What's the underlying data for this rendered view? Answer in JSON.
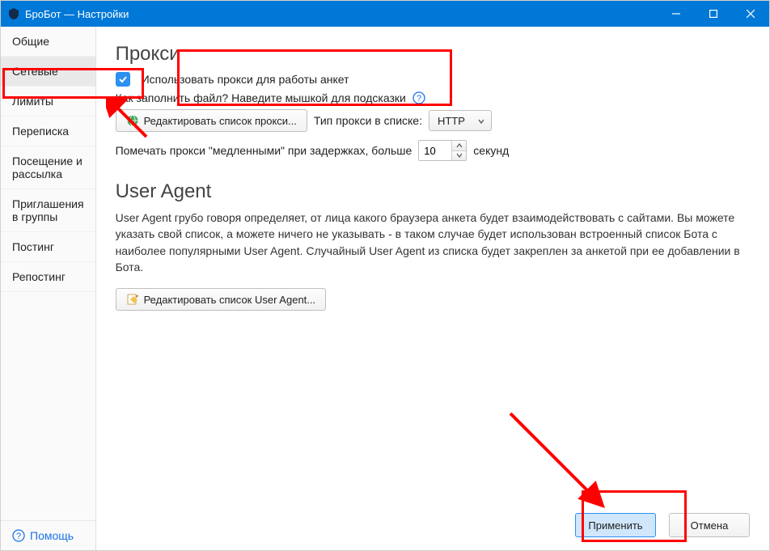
{
  "window": {
    "title": "БроБот — Настройки"
  },
  "sidebar": {
    "items": [
      {
        "label": "Общие"
      },
      {
        "label": "Сетевые",
        "selected": true
      },
      {
        "label": "Лимиты"
      },
      {
        "label": "Переписка"
      },
      {
        "label": "Посещение и рассылка"
      },
      {
        "label": "Приглашения в группы"
      },
      {
        "label": "Постинг"
      },
      {
        "label": "Репостинг"
      }
    ],
    "help": "Помощь"
  },
  "proxy": {
    "heading": "Прокси",
    "use_proxy_label": "Использовать прокси для работы анкет",
    "use_proxy_checked": true,
    "howto_text": "Как заполнить файл? Наведите мышкой для подсказки",
    "edit_list_label": "Редактировать список прокси...",
    "type_label": "Тип прокси в списке:",
    "type_value": "HTTP",
    "slow_label_pre": "Помечать прокси \"медленными\" при задержках, больше",
    "slow_value": "10",
    "slow_label_post": "секунд"
  },
  "useragent": {
    "heading": "User Agent",
    "desc": "User Agent грубо говоря определяет, от лица какого браузера анкета будет взаимодействовать с сайтами. Вы можете указать свой список, а можете ничего не указывать - в таком случае будет использован встроенный список Бота с наиболее популярными User Agent. Случайный User Agent из списка будет закреплен за анкетой при ее добавлении в Бота.",
    "edit_list_label": "Редактировать список User Agent..."
  },
  "footer": {
    "apply": "Применить",
    "cancel": "Отмена"
  }
}
